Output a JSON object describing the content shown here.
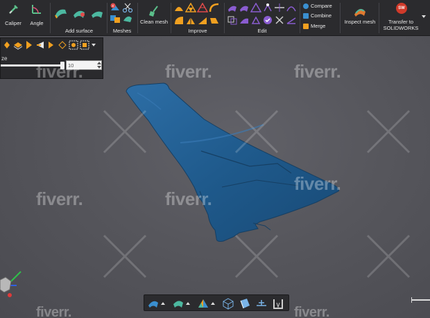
{
  "ribbon": {
    "caliper_label": "Caliper",
    "angle_label": "Angle",
    "add_surface_label": "Add surface",
    "meshes_label": "Meshes",
    "clean_mesh_label": "Clean mesh",
    "improve_label": "Improve",
    "edit_label": "Edit",
    "compare_label": "Compare",
    "combine_label": "Combine",
    "merge_label": "Merge",
    "inspect_mesh_label": "Inspect mesh",
    "transfer_label_line1": "Transfer to",
    "transfer_label_line2": "SOLIDWORKS",
    "sw_badge": "SW"
  },
  "float_toolbar": {
    "size_label": "ze",
    "size_value": "10",
    "slider_fraction": 0.94
  },
  "watermark": {
    "text": "fiverr."
  },
  "colors": {
    "accent_orange": "#f0a020",
    "mesh_blue": "#1f5a8c",
    "ribbon_bg": "#2b2b2e",
    "viewport_bg": "#58585e",
    "purple_icon": "#8a5cd0"
  }
}
